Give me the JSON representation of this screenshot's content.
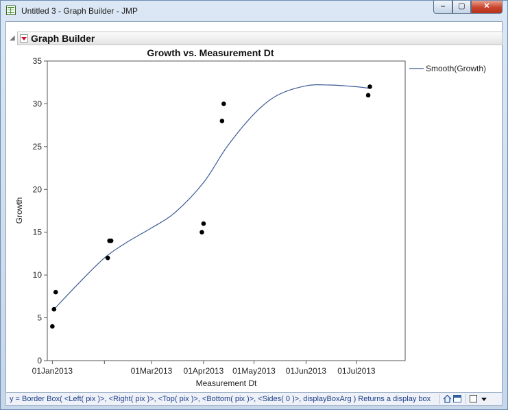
{
  "window": {
    "title": "Untitled 3 - Graph Builder - JMP",
    "min_glyph": "–",
    "max_glyph": "▢",
    "close_glyph": "✕"
  },
  "outline": {
    "disclosure": "◢",
    "title": "Graph Builder"
  },
  "status": {
    "text": "y = Border Box( <Left( pix )>, <Right( pix )>, <Top( pix )>, <Bottom( pix )>, <Sides( 0 )>, displayBoxArg )  Returns a display box"
  },
  "chart_data": {
    "type": "scatter",
    "title": "Growth vs. Measurement Dt",
    "xlabel": "Measurement Dt",
    "ylabel": "Growth",
    "ylim": [
      0,
      35
    ],
    "yticks": [
      "0",
      "5",
      "10",
      "15",
      "20",
      "25",
      "30",
      "35"
    ],
    "xlim": [
      "2012-12-29",
      "2013-07-30"
    ],
    "xticks": [
      {
        "date": "2013-01-01",
        "label": "01Jan2013"
      },
      {
        "date": "2013-02-01",
        "label": ""
      },
      {
        "date": "2013-03-01",
        "label": "01Mar2013"
      },
      {
        "date": "2013-04-01",
        "label": "01Apr2013"
      },
      {
        "date": "2013-05-01",
        "label": "01May2013"
      },
      {
        "date": "2013-06-01",
        "label": "01Jun2013"
      },
      {
        "date": "2013-07-01",
        "label": "01Jul2013"
      }
    ],
    "grid": false,
    "legend": {
      "position": "right",
      "entries": [
        "Smooth(Growth)"
      ]
    },
    "series": [
      {
        "kind": "points",
        "x": [
          "2013-01-01",
          "2013-01-02",
          "2013-01-03",
          "2013-02-03",
          "2013-02-04",
          "2013-02-05",
          "2013-03-31",
          "2013-04-01",
          "2013-04-12",
          "2013-04-13",
          "2013-07-08",
          "2013-07-09"
        ],
        "y": [
          4,
          6,
          8,
          12,
          14,
          14,
          15,
          16,
          28,
          30,
          31,
          32
        ]
      },
      {
        "kind": "line",
        "name": "Smooth(Growth)",
        "x": [
          "2013-01-02",
          "2013-01-15",
          "2013-02-01",
          "2013-02-15",
          "2013-03-01",
          "2013-03-15",
          "2013-04-01",
          "2013-04-15",
          "2013-05-01",
          "2013-05-15",
          "2013-06-01",
          "2013-06-15",
          "2013-07-01",
          "2013-07-09"
        ],
        "y": [
          6,
          8.7,
          12,
          13.9,
          15.5,
          17.3,
          20.8,
          25,
          28.8,
          31,
          32.1,
          32.2,
          32,
          31.8
        ]
      }
    ],
    "colors": {
      "points": "#000000",
      "smooth": "#3c5a94"
    }
  }
}
